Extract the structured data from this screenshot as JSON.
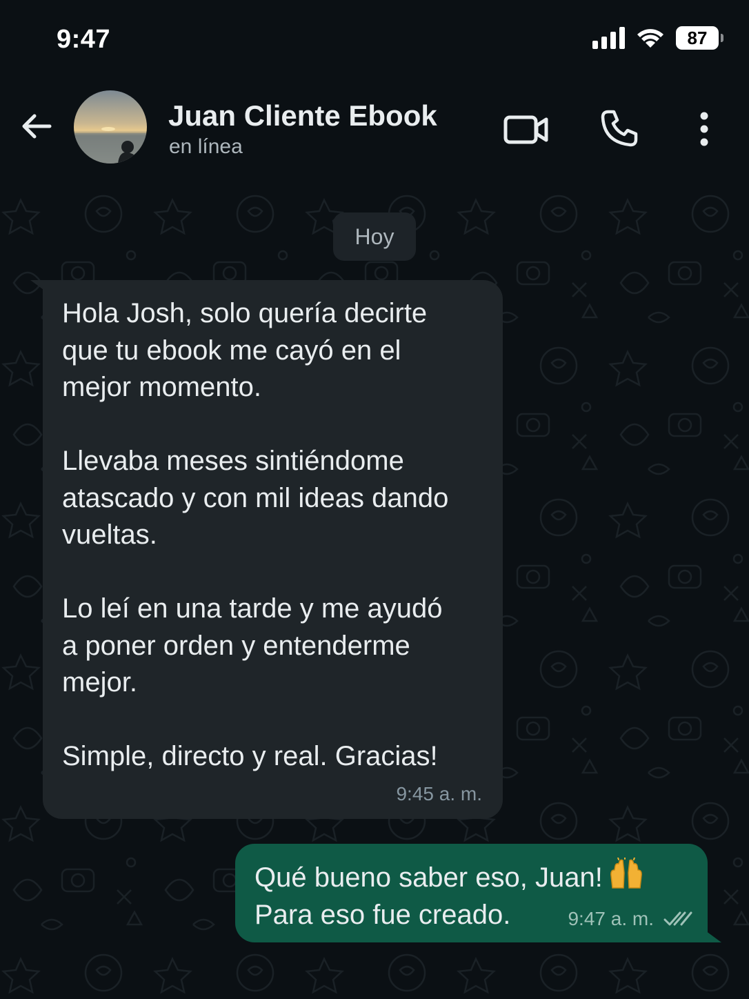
{
  "status_bar": {
    "time": "9:47",
    "battery_level": "87",
    "icons": [
      "signal-icon",
      "wifi-icon",
      "battery-icon"
    ]
  },
  "header": {
    "contact_name": "Juan Cliente Ebook",
    "contact_status": "en línea",
    "icons": [
      "back-arrow-icon",
      "avatar",
      "video-camera-icon",
      "phone-icon",
      "more-vertical-icon"
    ]
  },
  "chat": {
    "date_label": "Hoy",
    "messages": [
      {
        "direction": "incoming",
        "paragraphs": [
          "Hola Josh, solo quería decirte\nque tu ebook me cayó en el\nmejor momento.",
          "Llevaba meses sintiéndome\natascado y con mil ideas dando\nvueltas.",
          "Lo leí en una tarde y me ayudó\na poner orden y entenderme\nmejor.",
          "Simple, directo y real. Gracias!"
        ],
        "time": "9:45 a. m."
      },
      {
        "direction": "outgoing",
        "lines": [
          "Qué bueno saber eso, Juan!",
          "Para eso fue creado."
        ],
        "emoji": "raising-hands-icon",
        "time": "9:47 a. m.",
        "status_icon": "double-check-read-icon"
      }
    ]
  },
  "colors": {
    "background": "#0b1014",
    "incoming_bubble": "#1f2529",
    "outgoing_bubble": "#0f5a46",
    "text": "#e9edef",
    "muted_text": "#8696a0"
  }
}
